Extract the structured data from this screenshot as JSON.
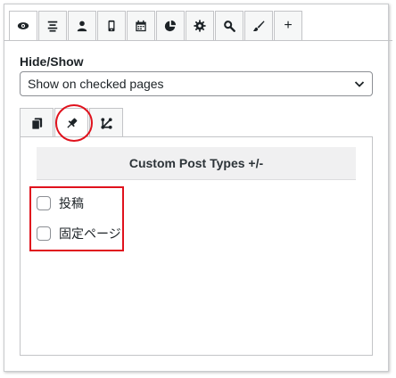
{
  "toolbar": {
    "tabs": [
      {
        "icon": "eye-icon"
      },
      {
        "icon": "align-center-icon"
      },
      {
        "icon": "user-icon"
      },
      {
        "icon": "mobile-icon"
      },
      {
        "icon": "calendar-icon"
      },
      {
        "icon": "pie-chart-icon"
      },
      {
        "icon": "gear-icon"
      },
      {
        "icon": "search-icon"
      },
      {
        "icon": "brush-icon"
      }
    ],
    "add_label": "+",
    "active_tab": 0
  },
  "visibility": {
    "label": "Hide/Show",
    "select_value": "Show on checked pages"
  },
  "subtabs": [
    {
      "icon": "pages-icon"
    },
    {
      "icon": "pushpin-icon",
      "active": true
    },
    {
      "icon": "taxonomy-icon"
    }
  ],
  "panel": {
    "header": "Custom Post Types +/-",
    "items": [
      {
        "label": "投稿",
        "checked": false
      },
      {
        "label": "固定ページ",
        "checked": false
      }
    ]
  },
  "colors": {
    "highlight": "#e0121d",
    "border": "#c3c4c7",
    "header_bg": "#f0f0f1"
  }
}
